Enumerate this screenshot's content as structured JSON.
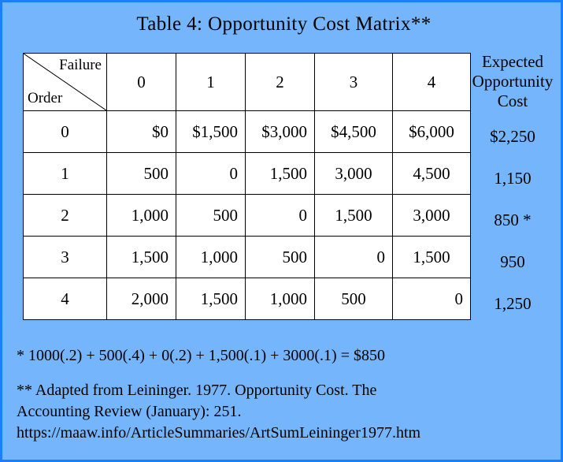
{
  "slide": {
    "title": "Table 4: Opportunity Cost Matrix**",
    "background_color": "#75b5fc",
    "border_color": "#1a7ffa"
  },
  "matrix": {
    "corner": {
      "column_axis_label": "Failure",
      "row_axis_label": "Order"
    },
    "column_headers": [
      "0",
      "1",
      "2",
      "3",
      "4"
    ],
    "row_headers": [
      "0",
      "1",
      "2",
      "3",
      "4"
    ],
    "rows": [
      {
        "header": "0",
        "cells": [
          "$0",
          "$1,500",
          "$3,000",
          "$4,500",
          "$6,000"
        ]
      },
      {
        "header": "1",
        "cells": [
          "500",
          "0",
          "1,500",
          "3,000",
          "4,500"
        ]
      },
      {
        "header": "2",
        "cells": [
          "1,000",
          "500",
          "0",
          "1,500",
          "3,000"
        ]
      },
      {
        "header": "3",
        "cells": [
          "1,500",
          "1,000",
          "500",
          "0",
          "1,500"
        ]
      },
      {
        "header": "4",
        "cells": [
          "2,000",
          "1,500",
          "1,000",
          "500",
          "0"
        ]
      }
    ]
  },
  "expected_opportunity_cost": {
    "header_line1": "Expected",
    "header_line2": "Opportunity",
    "header_line3": "Cost",
    "values": [
      "$2,250",
      "1,150",
      "850 *",
      "950",
      "1,250"
    ]
  },
  "footnotes": {
    "star": "* 1000(.2) + 500(.4) + 0(.2) + 1,500(.1) + 3000(.1) = $850",
    "source_line1": "**  Adapted from Leininger.  1977.  Opportunity Cost.  The",
    "source_line2": "Accounting Review (January): 251.",
    "source_line3": "https://maaw.info/ArticleSummaries/ArtSumLeininger1977.htm"
  },
  "chart_data": {
    "type": "table",
    "title": "Table 4: Opportunity Cost Matrix**",
    "xlabel": "Failure",
    "ylabel": "Order",
    "categories": [
      "0",
      "1",
      "2",
      "3",
      "4"
    ],
    "series": [
      {
        "name": "Order 0",
        "values": [
          0,
          1500,
          3000,
          4500,
          6000
        ],
        "expected_opportunity_cost": 2250
      },
      {
        "name": "Order 1",
        "values": [
          500,
          0,
          1500,
          3000,
          4500
        ],
        "expected_opportunity_cost": 1150
      },
      {
        "name": "Order 2",
        "values": [
          1000,
          500,
          0,
          1500,
          3000
        ],
        "expected_opportunity_cost": 850
      },
      {
        "name": "Order 3",
        "values": [
          1500,
          1000,
          500,
          0,
          1500
        ],
        "expected_opportunity_cost": 950
      },
      {
        "name": "Order 4",
        "values": [
          2000,
          1500,
          1000,
          500,
          0
        ],
        "expected_opportunity_cost": 1250
      }
    ],
    "probabilities": [
      0.2,
      0.4,
      0.2,
      0.1,
      0.1
    ],
    "optimal_row": "2",
    "grid": true,
    "legend": "none"
  }
}
